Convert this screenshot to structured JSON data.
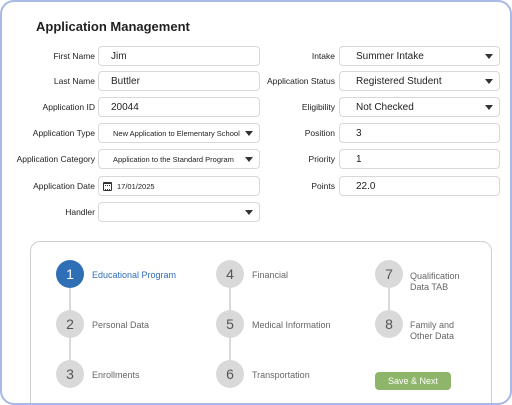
{
  "page": {
    "title": "Application Management"
  },
  "form_left": [
    {
      "label": "First Name",
      "value": "Jim",
      "type": "text"
    },
    {
      "label": "Last Name",
      "value": "Buttler",
      "type": "text"
    },
    {
      "label": "Application ID",
      "value": "20044",
      "type": "text"
    },
    {
      "label": "Application Type",
      "value": "New Application to Elementary School",
      "type": "select"
    },
    {
      "label": "Application Category",
      "value": "Application to the Standard Program",
      "type": "select"
    },
    {
      "label": "Application Date",
      "value": "17/01/2025",
      "type": "date"
    },
    {
      "label": "Handler",
      "value": "",
      "type": "select"
    }
  ],
  "form_right": [
    {
      "label": "Intake",
      "value": "Summer Intake",
      "type": "select"
    },
    {
      "label": "Application Status",
      "value": "Registered Student",
      "type": "select"
    },
    {
      "label": "Eligibility",
      "value": "Not Checked",
      "type": "select"
    },
    {
      "label": "Position",
      "value": "3",
      "type": "text"
    },
    {
      "label": "Priority",
      "value": "1",
      "type": "text"
    },
    {
      "label": "Points",
      "value": "22.0",
      "type": "text"
    }
  ],
  "steps": [
    {
      "number": "1",
      "label": "Educational Program",
      "active": true
    },
    {
      "number": "2",
      "label": "Personal Data",
      "active": false
    },
    {
      "number": "3",
      "label": "Enrollments",
      "active": false
    },
    {
      "number": "4",
      "label": "Financial",
      "active": false
    },
    {
      "number": "5",
      "label": "Medical Information",
      "active": false
    },
    {
      "number": "6",
      "label": "Transportation",
      "active": false
    },
    {
      "number": "7",
      "label_line1": "Qualification",
      "label_line2": "Data TAB",
      "active": false
    },
    {
      "number": "8",
      "label_line1": "Family and",
      "label_line2": "Other Data",
      "active": false
    }
  ],
  "actions": {
    "save_next": "Save & Next"
  },
  "colors": {
    "accent": "#2f6fb5",
    "save_button": "#8fb56a",
    "frame_border": "#a9b8e6"
  }
}
